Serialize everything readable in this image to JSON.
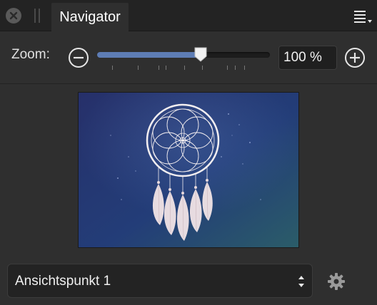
{
  "tab": {
    "title": "Navigator"
  },
  "zoom": {
    "label": "Zoom:",
    "value": "100 %",
    "slider_fraction": 0.6
  },
  "viewpoint": {
    "selected": "Ansichtspunkt 1"
  },
  "icons": {
    "close": "close-icon",
    "menu": "panel-menu-icon",
    "zoom_out": "minus-circle-icon",
    "zoom_in": "plus-circle-icon",
    "settings": "gear-icon"
  },
  "colors": {
    "accent": "#5e7db5",
    "preview_bg_a": "#27336e",
    "preview_bg_b": "#2a5b68"
  }
}
